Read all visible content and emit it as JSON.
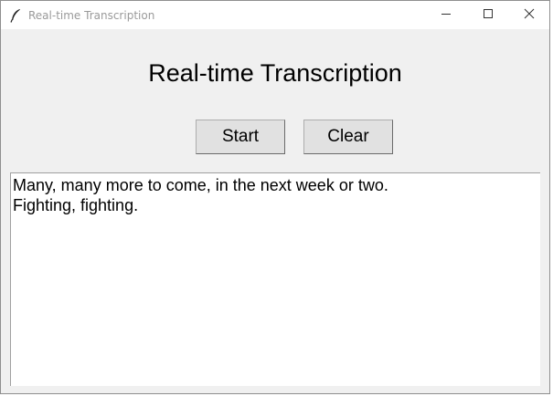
{
  "window": {
    "title": "Real-time Transcription",
    "app_icon": "feather-icon",
    "controls": [
      "minimize-icon",
      "maximize-icon",
      "close-icon"
    ]
  },
  "main": {
    "heading": "Real-time Transcription",
    "start_label": "Start",
    "clear_label": "Clear"
  },
  "transcript": {
    "lines": [
      "Many, many more to come, in the next week or two.",
      "Fighting, fighting."
    ]
  }
}
